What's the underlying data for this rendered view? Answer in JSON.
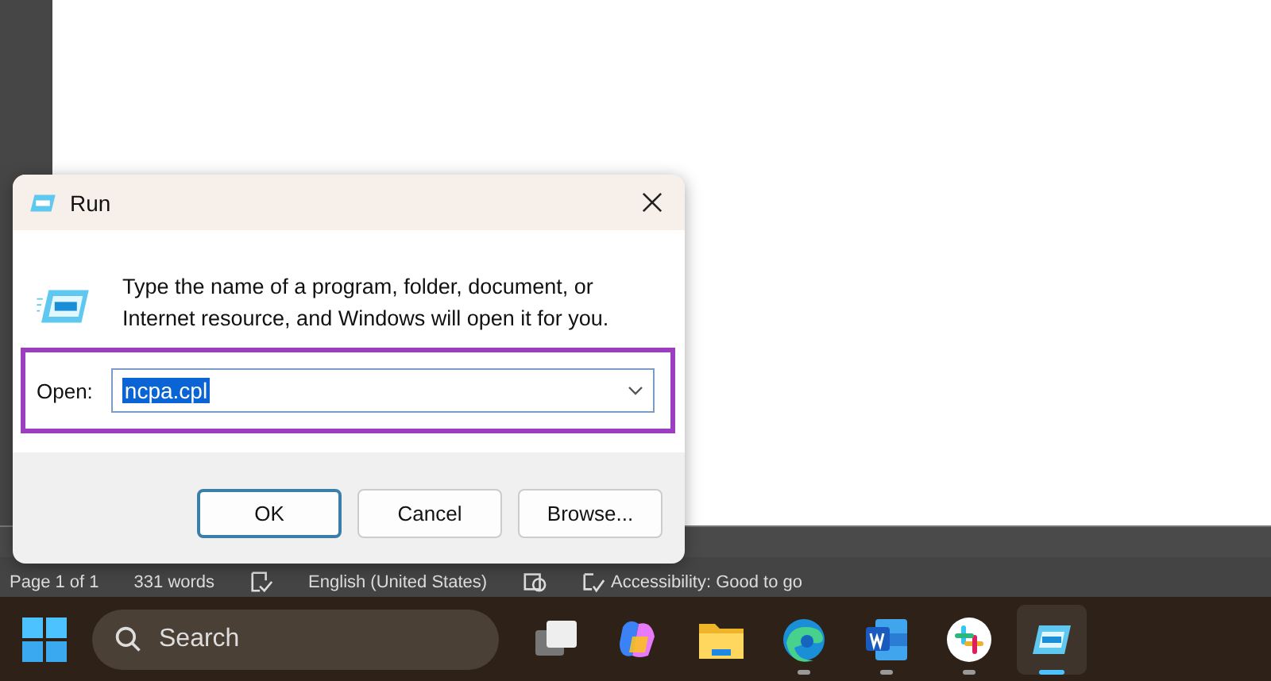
{
  "status_bar": {
    "items": [
      "Page 1 of 1",
      "331 words",
      "English (United States)",
      "Accessibility: Good to go"
    ]
  },
  "dialog": {
    "title": "Run",
    "message": "Type the name of a program, folder, document, or Internet resource, and Windows will open it for you.",
    "open_label": "Open:",
    "open_value": "ncpa.cpl",
    "value_selected": true,
    "highlighted": true,
    "buttons": [
      {
        "label": "OK",
        "default": true
      },
      {
        "label": "Cancel",
        "default": false
      },
      {
        "label": "Browse...",
        "default": false
      }
    ]
  },
  "taskbar": {
    "search_placeholder": "Search",
    "apps": [
      {
        "kind": "taskview",
        "running": false,
        "active": false
      },
      {
        "kind": "copilot",
        "running": false,
        "active": false
      },
      {
        "kind": "folder",
        "running": false,
        "active": false
      },
      {
        "kind": "edge",
        "running": true,
        "active": false
      },
      {
        "kind": "word",
        "running": true,
        "active": false
      },
      {
        "kind": "slack",
        "running": true,
        "active": false
      },
      {
        "kind": "run",
        "running": true,
        "active": true
      }
    ]
  }
}
